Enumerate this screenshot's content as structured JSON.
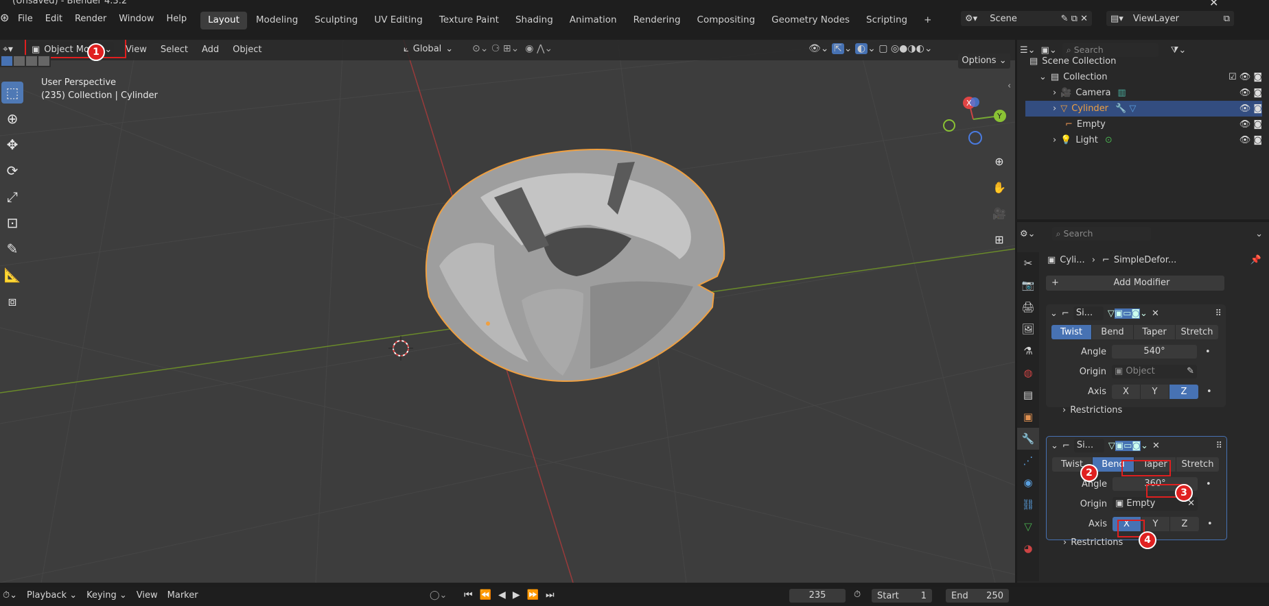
{
  "title_fragment": "(Unsaved) - Blender 4.3.2",
  "menu": [
    "File",
    "Edit",
    "Render",
    "Window",
    "Help"
  ],
  "workspaces": [
    "Layout",
    "Modeling",
    "Sculpting",
    "UV Editing",
    "Texture Paint",
    "Shading",
    "Animation",
    "Rendering",
    "Compositing",
    "Geometry Nodes",
    "Scripting"
  ],
  "active_workspace": "Layout",
  "scene": "Scene",
  "view_layer": "ViewLayer",
  "viewport": {
    "mode": "Object Mode",
    "menus": [
      "View",
      "Select",
      "Add",
      "Object"
    ],
    "transform_orientation": "Global",
    "options_label": "Options",
    "overlay_line1": "User Perspective",
    "overlay_line2": "(235) Collection | Cylinder",
    "gizmo": {
      "x": "X",
      "y": "Y",
      "z": "Z"
    }
  },
  "outliner": {
    "search_placeholder": "Search",
    "root": "Scene Collection",
    "collection": "Collection",
    "items": [
      {
        "name": "Camera",
        "selected": false
      },
      {
        "name": "Cylinder",
        "selected": true
      },
      {
        "name": "Empty",
        "selected": false
      },
      {
        "name": "Light",
        "selected": false
      }
    ]
  },
  "properties": {
    "search_placeholder": "Search",
    "breadcrumb_object": "Cyli...",
    "breadcrumb_modifier": "SimpleDefor...",
    "add_modifier": "Add Modifier",
    "modifiers": [
      {
        "name": "Si...",
        "modes": [
          "Twist",
          "Bend",
          "Taper",
          "Stretch"
        ],
        "active_mode": "Twist",
        "angle_label": "Angle",
        "angle": "540°",
        "origin_label": "Origin",
        "origin": "Object",
        "axis_label": "Axis",
        "axes": [
          "X",
          "Y",
          "Z"
        ],
        "active_axis": "Z",
        "restrictions": "Restrictions"
      },
      {
        "name": "Si...",
        "modes": [
          "Twist",
          "Bend",
          "Taper",
          "Stretch"
        ],
        "active_mode": "Bend",
        "angle_label": "Angle",
        "angle": "360°",
        "origin_label": "Origin",
        "origin": "Empty",
        "axis_label": "Axis",
        "axes": [
          "X",
          "Y",
          "Z"
        ],
        "active_axis": "X",
        "restrictions": "Restrictions"
      }
    ]
  },
  "timeline": {
    "menus": [
      "Playback",
      "Keying",
      "View",
      "Marker"
    ],
    "current_frame": "235",
    "start_label": "Start",
    "start": "1",
    "end_label": "End",
    "end": "250"
  },
  "annotations": [
    "1",
    "2",
    "3",
    "4"
  ],
  "colors": {
    "accent": "#4772b3",
    "selection": "#f0a040",
    "marker": "#e02020"
  }
}
